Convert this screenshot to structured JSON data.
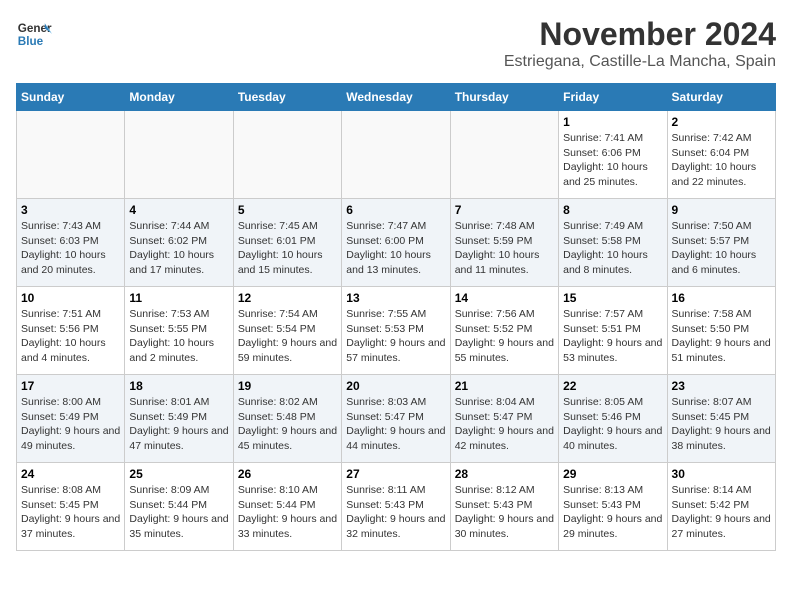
{
  "logo": {
    "line1": "General",
    "line2": "Blue"
  },
  "header": {
    "month": "November 2024",
    "location": "Estriegana, Castille-La Mancha, Spain"
  },
  "days_of_week": [
    "Sunday",
    "Monday",
    "Tuesday",
    "Wednesday",
    "Thursday",
    "Friday",
    "Saturday"
  ],
  "weeks": [
    [
      {
        "day": "",
        "info": ""
      },
      {
        "day": "",
        "info": ""
      },
      {
        "day": "",
        "info": ""
      },
      {
        "day": "",
        "info": ""
      },
      {
        "day": "",
        "info": ""
      },
      {
        "day": "1",
        "info": "Sunrise: 7:41 AM\nSunset: 6:06 PM\nDaylight: 10 hours and 25 minutes."
      },
      {
        "day": "2",
        "info": "Sunrise: 7:42 AM\nSunset: 6:04 PM\nDaylight: 10 hours and 22 minutes."
      }
    ],
    [
      {
        "day": "3",
        "info": "Sunrise: 7:43 AM\nSunset: 6:03 PM\nDaylight: 10 hours and 20 minutes."
      },
      {
        "day": "4",
        "info": "Sunrise: 7:44 AM\nSunset: 6:02 PM\nDaylight: 10 hours and 17 minutes."
      },
      {
        "day": "5",
        "info": "Sunrise: 7:45 AM\nSunset: 6:01 PM\nDaylight: 10 hours and 15 minutes."
      },
      {
        "day": "6",
        "info": "Sunrise: 7:47 AM\nSunset: 6:00 PM\nDaylight: 10 hours and 13 minutes."
      },
      {
        "day": "7",
        "info": "Sunrise: 7:48 AM\nSunset: 5:59 PM\nDaylight: 10 hours and 11 minutes."
      },
      {
        "day": "8",
        "info": "Sunrise: 7:49 AM\nSunset: 5:58 PM\nDaylight: 10 hours and 8 minutes."
      },
      {
        "day": "9",
        "info": "Sunrise: 7:50 AM\nSunset: 5:57 PM\nDaylight: 10 hours and 6 minutes."
      }
    ],
    [
      {
        "day": "10",
        "info": "Sunrise: 7:51 AM\nSunset: 5:56 PM\nDaylight: 10 hours and 4 minutes."
      },
      {
        "day": "11",
        "info": "Sunrise: 7:53 AM\nSunset: 5:55 PM\nDaylight: 10 hours and 2 minutes."
      },
      {
        "day": "12",
        "info": "Sunrise: 7:54 AM\nSunset: 5:54 PM\nDaylight: 9 hours and 59 minutes."
      },
      {
        "day": "13",
        "info": "Sunrise: 7:55 AM\nSunset: 5:53 PM\nDaylight: 9 hours and 57 minutes."
      },
      {
        "day": "14",
        "info": "Sunrise: 7:56 AM\nSunset: 5:52 PM\nDaylight: 9 hours and 55 minutes."
      },
      {
        "day": "15",
        "info": "Sunrise: 7:57 AM\nSunset: 5:51 PM\nDaylight: 9 hours and 53 minutes."
      },
      {
        "day": "16",
        "info": "Sunrise: 7:58 AM\nSunset: 5:50 PM\nDaylight: 9 hours and 51 minutes."
      }
    ],
    [
      {
        "day": "17",
        "info": "Sunrise: 8:00 AM\nSunset: 5:49 PM\nDaylight: 9 hours and 49 minutes."
      },
      {
        "day": "18",
        "info": "Sunrise: 8:01 AM\nSunset: 5:49 PM\nDaylight: 9 hours and 47 minutes."
      },
      {
        "day": "19",
        "info": "Sunrise: 8:02 AM\nSunset: 5:48 PM\nDaylight: 9 hours and 45 minutes."
      },
      {
        "day": "20",
        "info": "Sunrise: 8:03 AM\nSunset: 5:47 PM\nDaylight: 9 hours and 44 minutes."
      },
      {
        "day": "21",
        "info": "Sunrise: 8:04 AM\nSunset: 5:47 PM\nDaylight: 9 hours and 42 minutes."
      },
      {
        "day": "22",
        "info": "Sunrise: 8:05 AM\nSunset: 5:46 PM\nDaylight: 9 hours and 40 minutes."
      },
      {
        "day": "23",
        "info": "Sunrise: 8:07 AM\nSunset: 5:45 PM\nDaylight: 9 hours and 38 minutes."
      }
    ],
    [
      {
        "day": "24",
        "info": "Sunrise: 8:08 AM\nSunset: 5:45 PM\nDaylight: 9 hours and 37 minutes."
      },
      {
        "day": "25",
        "info": "Sunrise: 8:09 AM\nSunset: 5:44 PM\nDaylight: 9 hours and 35 minutes."
      },
      {
        "day": "26",
        "info": "Sunrise: 8:10 AM\nSunset: 5:44 PM\nDaylight: 9 hours and 33 minutes."
      },
      {
        "day": "27",
        "info": "Sunrise: 8:11 AM\nSunset: 5:43 PM\nDaylight: 9 hours and 32 minutes."
      },
      {
        "day": "28",
        "info": "Sunrise: 8:12 AM\nSunset: 5:43 PM\nDaylight: 9 hours and 30 minutes."
      },
      {
        "day": "29",
        "info": "Sunrise: 8:13 AM\nSunset: 5:43 PM\nDaylight: 9 hours and 29 minutes."
      },
      {
        "day": "30",
        "info": "Sunrise: 8:14 AM\nSunset: 5:42 PM\nDaylight: 9 hours and 27 minutes."
      }
    ]
  ]
}
